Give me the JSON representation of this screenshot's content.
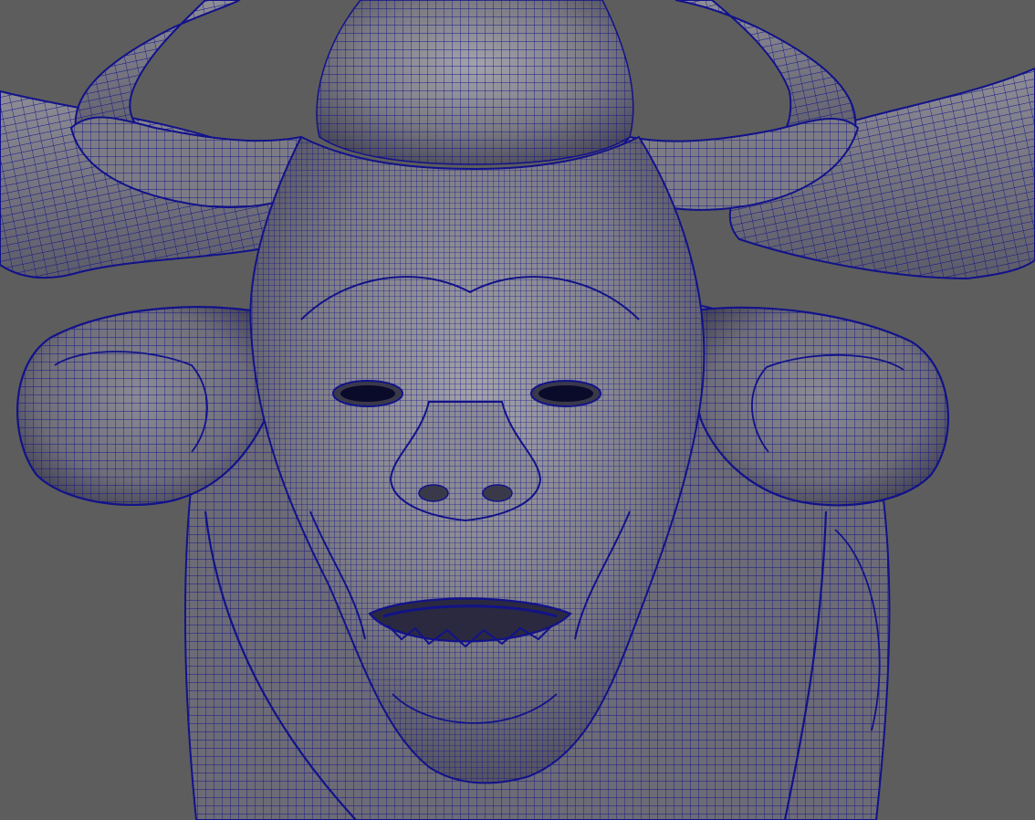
{
  "viewport": {
    "background": "#5d5d5d",
    "shading": "wireframe-on-shaded",
    "subject": "creature-head-mesh"
  },
  "colors": {
    "wire": "#12128a",
    "skin": "#7c7b84",
    "skin_light": "#a3a2ab",
    "skin_dark": "#3c3b4a",
    "cavity": "#0a0a2a"
  }
}
